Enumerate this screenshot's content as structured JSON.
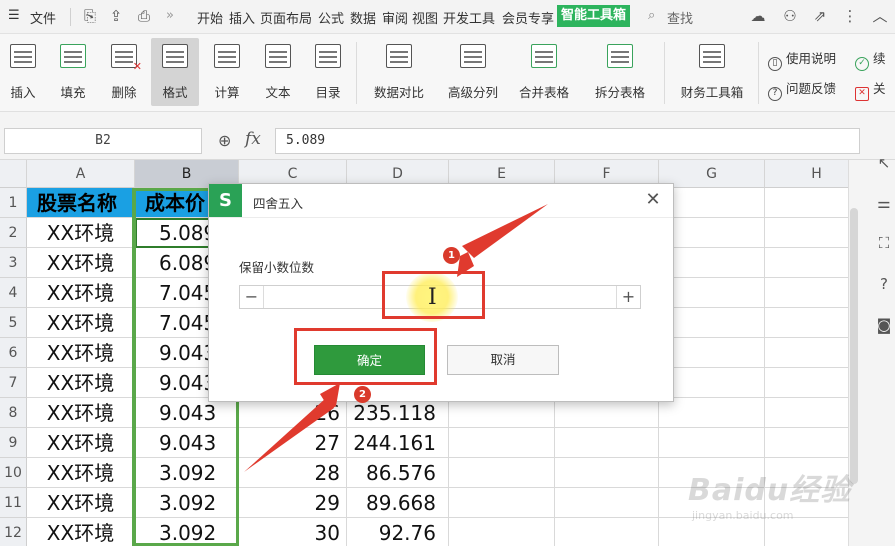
{
  "menubar": {
    "file": "文件",
    "tabs": [
      "开始",
      "插入",
      "页面布局",
      "公式",
      "数据",
      "审阅",
      "视图",
      "开发工具",
      "会员专享"
    ],
    "active_tab": "智能工具箱",
    "search": "查找",
    "active_tab_color": "#2db45d"
  },
  "ribbon": {
    "buttons": [
      "插入",
      "填充",
      "删除",
      "格式",
      "计算",
      "文本",
      "目录",
      "数据对比",
      "高级分列",
      "合并表格",
      "拆分表格",
      "财务工具箱"
    ],
    "side_items": [
      "使用说明",
      "问题反馈",
      "续",
      "关"
    ]
  },
  "formula_bar": {
    "cell_ref": "B2",
    "fx": "fx",
    "value": "5.089"
  },
  "grid": {
    "columns": [
      "A",
      "B",
      "C",
      "D",
      "E",
      "F",
      "G",
      "H"
    ],
    "rows": [
      "1",
      "2",
      "3",
      "4",
      "5",
      "6",
      "7",
      "8",
      "9",
      "10",
      "11",
      "12"
    ],
    "header": {
      "a": "股票名称",
      "b": "成本价"
    },
    "data": [
      {
        "a": "XX环境",
        "b": "5.089",
        "c": "",
        "d": ""
      },
      {
        "a": "XX环境",
        "b": "6.089",
        "c": "",
        "d": ""
      },
      {
        "a": "XX环境",
        "b": "7.045",
        "c": "",
        "d": ""
      },
      {
        "a": "XX环境",
        "b": "7.045",
        "c": "",
        "d": ""
      },
      {
        "a": "XX环境",
        "b": "9.043",
        "c": "",
        "d": ""
      },
      {
        "a": "XX环境",
        "b": "9.043",
        "c": "",
        "d": ""
      },
      {
        "a": "XX环境",
        "b": "9.043",
        "c": "26",
        "d": "235.118"
      },
      {
        "a": "XX环境",
        "b": "9.043",
        "c": "27",
        "d": "244.161"
      },
      {
        "a": "XX环境",
        "b": "3.092",
        "c": "28",
        "d": "86.576"
      },
      {
        "a": "XX环境",
        "b": "3.092",
        "c": "29",
        "d": "89.668"
      },
      {
        "a": "XX环境",
        "b": "3.092",
        "c": "30",
        "d": "92.76"
      }
    ],
    "header_fill": "#1aa0e3"
  },
  "dialog": {
    "title": "四舍五入",
    "logo": "S",
    "label": "保留小数位数",
    "stepper_value": "",
    "minus": "−",
    "plus": "+",
    "ok": "确定",
    "cancel": "取消",
    "close": "✕"
  },
  "annotations": {
    "badge_1": "1",
    "badge_2": "2",
    "color": "#e03a2e"
  },
  "watermark": {
    "main": "Baidu经验",
    "sub": "jingyan.baidu.com"
  }
}
